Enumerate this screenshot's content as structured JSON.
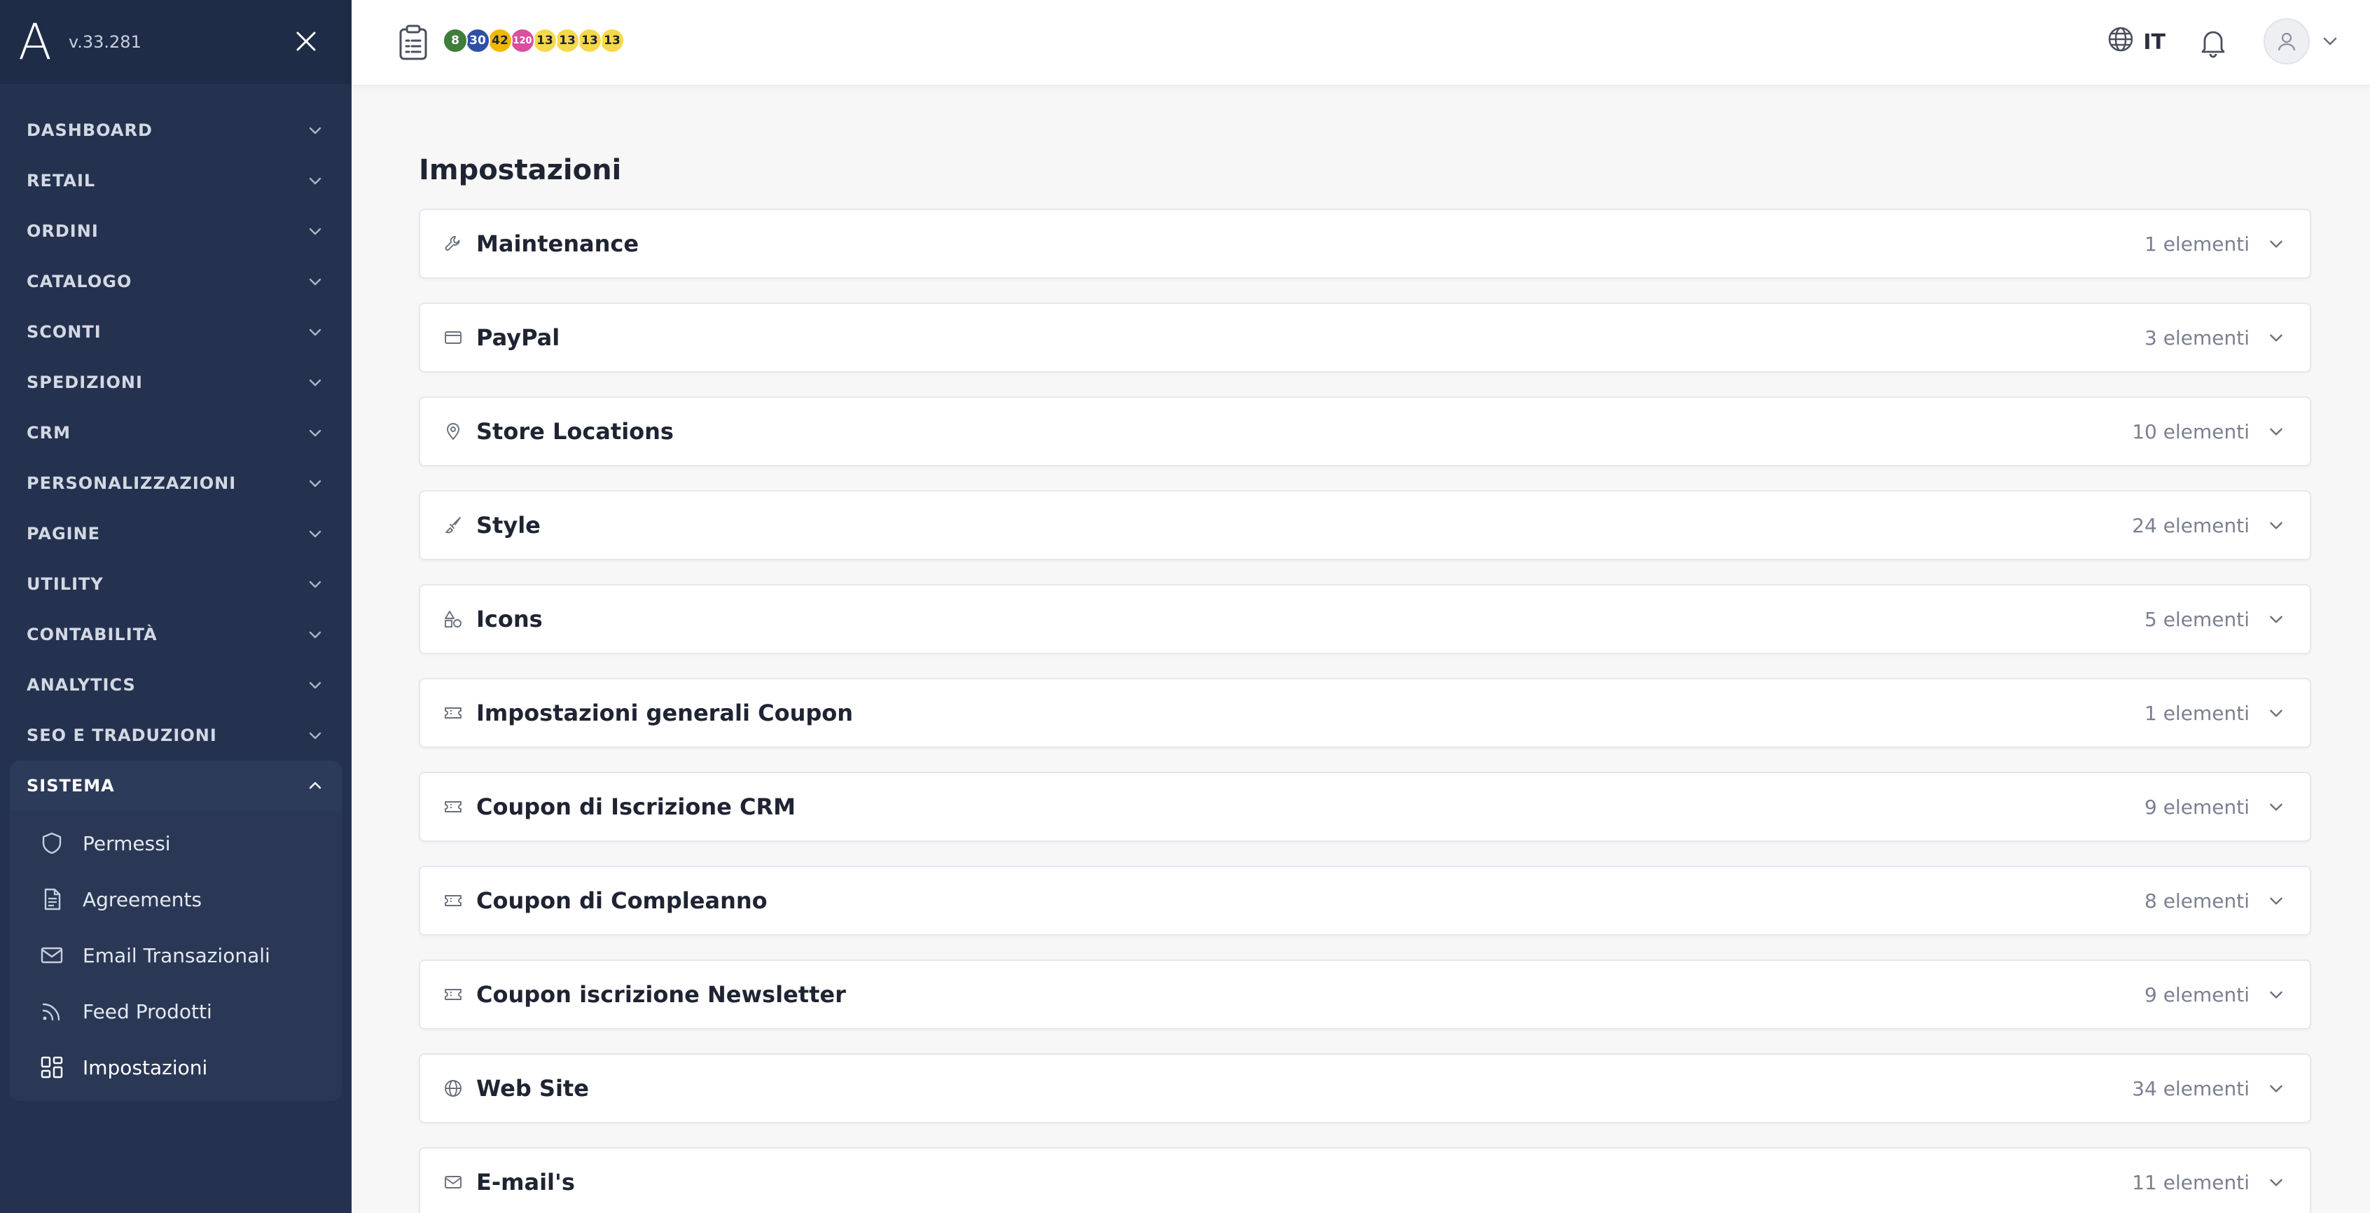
{
  "sidebar": {
    "logo": "A",
    "version": "v.33.281",
    "menu": [
      {
        "label": "DASHBOARD"
      },
      {
        "label": "RETAIL"
      },
      {
        "label": "ORDINI"
      },
      {
        "label": "CATALOGO"
      },
      {
        "label": "SCONTI"
      },
      {
        "label": "SPEDIZIONI"
      },
      {
        "label": "CRM"
      },
      {
        "label": "PERSONALIZZAZIONI"
      },
      {
        "label": "PAGINE"
      },
      {
        "label": "UTILITY"
      },
      {
        "label": "CONTABILITÀ"
      },
      {
        "label": "ANALYTICS"
      },
      {
        "label": "SEO E TRADUZIONI"
      }
    ],
    "open_section": {
      "label": "SISTEMA",
      "items": [
        {
          "label": "Permessi",
          "icon": "shield-icon"
        },
        {
          "label": "Agreements",
          "icon": "document-icon"
        },
        {
          "label": "Email Transazionali",
          "icon": "mail-icon"
        },
        {
          "label": "Feed Prodotti",
          "icon": "rss-icon"
        },
        {
          "label": "Impostazioni",
          "icon": "grid-icon",
          "active": true
        }
      ]
    }
  },
  "topbar": {
    "badges": [
      {
        "value": "8",
        "bg": "#3f7d3a",
        "fg": "#ffffff"
      },
      {
        "value": "30",
        "bg": "#2f4fa8",
        "fg": "#ffffff"
      },
      {
        "value": "42",
        "bg": "#f2b705",
        "fg": "#1f2433"
      },
      {
        "value": "120",
        "bg": "#d94f9e",
        "fg": "#ffffff"
      },
      {
        "value": "13",
        "bg": "#f6d84a",
        "fg": "#1f2433"
      },
      {
        "value": "13",
        "bg": "#f6d84a",
        "fg": "#1f2433"
      },
      {
        "value": "13",
        "bg": "#f6d84a",
        "fg": "#1f2433"
      },
      {
        "value": "13",
        "bg": "#f6d84a",
        "fg": "#1f2433"
      }
    ],
    "language": "IT"
  },
  "main": {
    "title": "Impostazioni",
    "rows": [
      {
        "title": "Maintenance",
        "count": "1 elementi",
        "icon": "wrench-icon"
      },
      {
        "title": "PayPal",
        "count": "3 elementi",
        "icon": "card-icon"
      },
      {
        "title": "Store Locations",
        "count": "10 elementi",
        "icon": "map-pin-icon"
      },
      {
        "title": "Style",
        "count": "24 elementi",
        "icon": "brush-icon"
      },
      {
        "title": "Icons",
        "count": "5 elementi",
        "icon": "shapes-icon"
      },
      {
        "title": "Impostazioni generali Coupon",
        "count": "1 elementi",
        "icon": "ticket-icon"
      },
      {
        "title": "Coupon di Iscrizione CRM",
        "count": "9 elementi",
        "icon": "ticket-icon"
      },
      {
        "title": "Coupon di Compleanno",
        "count": "8 elementi",
        "icon": "ticket-icon"
      },
      {
        "title": "Coupon iscrizione Newsletter",
        "count": "9 elementi",
        "icon": "ticket-icon"
      },
      {
        "title": "Web Site",
        "count": "34 elementi",
        "icon": "globe-icon"
      },
      {
        "title": "E-mail's",
        "count": "11 elementi",
        "icon": "mail-icon"
      }
    ]
  },
  "colors": {
    "sidebar_bg": "#24324f",
    "sidebar_header_bg": "#1f2c47",
    "page_bg": "#f7f7f8"
  }
}
